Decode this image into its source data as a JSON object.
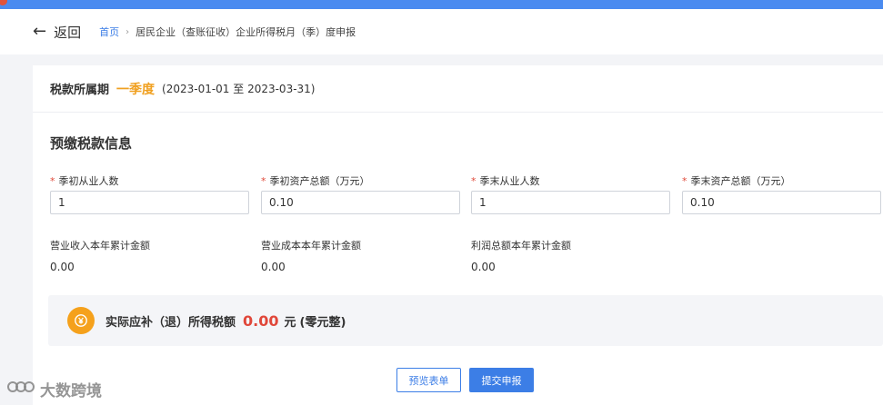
{
  "header": {
    "back_label": "返回",
    "breadcrumb_home": "首页",
    "breadcrumb_current": "居民企业（查账征收）企业所得税月（季）度申报"
  },
  "period": {
    "label": "税款所属期",
    "value": "一季度",
    "range": "(2023-01-01 至 2023-03-31)"
  },
  "section": {
    "title": "预缴税款信息"
  },
  "fields": [
    {
      "label": "季初从业人数",
      "value": "1",
      "required": true
    },
    {
      "label": "季初资产总额（万元）",
      "value": "0.10",
      "required": true
    },
    {
      "label": "季末从业人数",
      "value": "1",
      "required": true
    },
    {
      "label": "季末资产总额（万元）",
      "value": "0.10",
      "required": true
    }
  ],
  "stats": [
    {
      "label": "营业收入本年累计金额",
      "value": "0.00"
    },
    {
      "label": "营业成本本年累计金额",
      "value": "0.00"
    },
    {
      "label": "利润总额本年累计金额",
      "value": "0.00"
    }
  ],
  "tax": {
    "label": "实际应补（退）所得税额",
    "amount": "0.00",
    "unit": "元",
    "upper": "(零元整)"
  },
  "buttons": {
    "preview": "预览表单",
    "submit": "提交申报"
  },
  "watermark": {
    "text": "大数跨境"
  },
  "colors": {
    "accent": "#3c7ee6",
    "period": "#f0a020",
    "amount": "#e0473a",
    "coin": "#f5a11c",
    "required": "#e04a3a"
  }
}
